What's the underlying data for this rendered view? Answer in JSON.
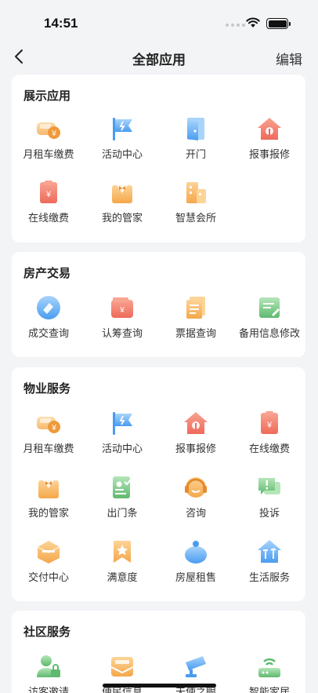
{
  "status": {
    "time": "14:51"
  },
  "nav": {
    "title": "全部应用",
    "edit_label": "编辑"
  },
  "sections": [
    {
      "title": "展示应用",
      "apps": [
        {
          "label": "月租车缴费",
          "icon": "car-pay-icon"
        },
        {
          "label": "活动中心",
          "icon": "flag-icon"
        },
        {
          "label": "开门",
          "icon": "door-icon"
        },
        {
          "label": "报事报修",
          "icon": "house-repair-icon"
        },
        {
          "label": "在线缴费",
          "icon": "bill-pay-icon"
        },
        {
          "label": "我的管家",
          "icon": "butler-icon"
        },
        {
          "label": "智慧会所",
          "icon": "clubhouse-icon"
        }
      ]
    },
    {
      "title": "房产交易",
      "apps": [
        {
          "label": "成交查询",
          "icon": "deal-query-icon"
        },
        {
          "label": "认筹查询",
          "icon": "wallet-icon"
        },
        {
          "label": "票据查询",
          "icon": "receipt-icon"
        },
        {
          "label": "备用信息修改",
          "icon": "edit-info-icon"
        }
      ]
    },
    {
      "title": "物业服务",
      "apps": [
        {
          "label": "月租车缴费",
          "icon": "car-pay-icon"
        },
        {
          "label": "活动中心",
          "icon": "flag-icon"
        },
        {
          "label": "报事报修",
          "icon": "house-repair-icon"
        },
        {
          "label": "在线缴费",
          "icon": "bill-pay-icon"
        },
        {
          "label": "我的管家",
          "icon": "butler-icon"
        },
        {
          "label": "出门条",
          "icon": "exit-pass-icon"
        },
        {
          "label": "咨询",
          "icon": "headset-icon"
        },
        {
          "label": "投诉",
          "icon": "complaint-icon"
        },
        {
          "label": "交付中心",
          "icon": "delivery-icon"
        },
        {
          "label": "满意度",
          "icon": "satisfaction-icon"
        },
        {
          "label": "房屋租售",
          "icon": "house-rent-icon"
        },
        {
          "label": "生活服务",
          "icon": "life-service-icon"
        }
      ]
    },
    {
      "title": "社区服务",
      "apps": [
        {
          "label": "访客邀请",
          "icon": "visitor-icon"
        },
        {
          "label": "便民信息",
          "icon": "info-mail-icon"
        },
        {
          "label": "天使之眼",
          "icon": "camera-icon"
        },
        {
          "label": "智能家居",
          "icon": "router-icon"
        }
      ]
    }
  ],
  "colors": {
    "orange": "#f5a74a",
    "red": "#ee6a5a",
    "blue": "#4a9cf0",
    "green": "#68c178"
  }
}
